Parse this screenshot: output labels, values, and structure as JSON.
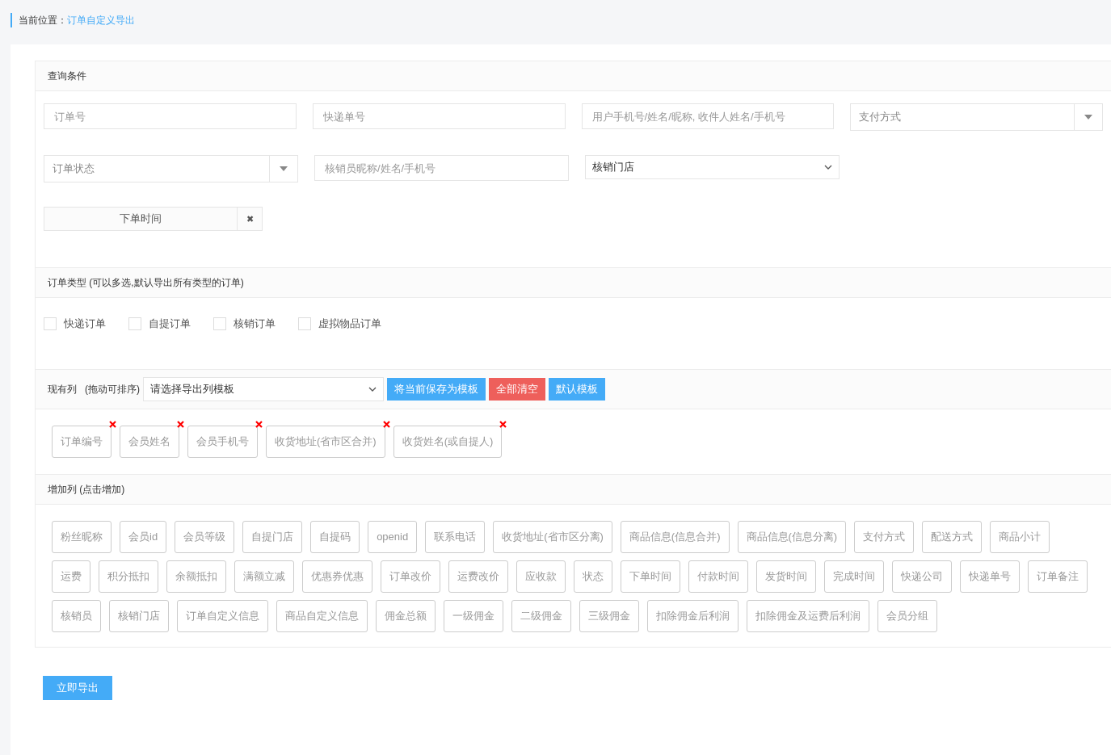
{
  "breadcrumb": {
    "label": "当前位置：",
    "current": "订单自定义导出"
  },
  "query": {
    "title": "查询条件",
    "rows": [
      [
        {
          "kind": "text",
          "placeholder": "订单号"
        },
        {
          "kind": "text",
          "placeholder": "快递单号"
        },
        {
          "kind": "text",
          "placeholder": "用户手机号/姓名/昵称, 收件人姓名/手机号"
        },
        {
          "kind": "select",
          "placeholder": "支付方式"
        }
      ],
      [
        {
          "kind": "select",
          "placeholder": "订单状态"
        },
        {
          "kind": "text",
          "placeholder": "核销员昵称/姓名/手机号"
        },
        {
          "kind": "dropdown",
          "value": "核销门店"
        }
      ],
      [
        {
          "kind": "date",
          "value": "下单时间",
          "clear": "✖"
        }
      ]
    ]
  },
  "order_type": {
    "title": "订单类型 (可以多选,默认导出所有类型的订单)",
    "options": [
      {
        "label": "快递订单",
        "checked": false
      },
      {
        "label": "自提订单",
        "checked": false
      },
      {
        "label": "核销订单",
        "checked": false
      },
      {
        "label": "虚拟物品订单",
        "checked": false
      }
    ]
  },
  "current_columns": {
    "title": "现有列",
    "hint": "(拖动可排序)",
    "template_select": "请选择导出列模板",
    "buttons": [
      {
        "label": "将当前保存为模板",
        "kind": "primary"
      },
      {
        "label": "全部清空",
        "kind": "danger"
      },
      {
        "label": "默认模板",
        "kind": "primary"
      }
    ],
    "columns": [
      "订单编号",
      "会员姓名",
      "会员手机号",
      "收货地址(省市区合并)",
      "收货姓名(或自提人)"
    ]
  },
  "add_columns": {
    "title": "增加列 (点击增加)",
    "columns": [
      "粉丝昵称",
      "会员id",
      "会员等级",
      "自提门店",
      "自提码",
      "openid",
      "联系电话",
      "收货地址(省市区分离)",
      "商品信息(信息合并)",
      "商品信息(信息分离)",
      "支付方式",
      "配送方式",
      "商品小计",
      "运费",
      "积分抵扣",
      "余额抵扣",
      "满额立减",
      "优惠券优惠",
      "订单改价",
      "运费改价",
      "应收款",
      "状态",
      "下单时间",
      "付款时间",
      "发货时间",
      "完成时间",
      "快递公司",
      "快递单号",
      "订单备注",
      "核销员",
      "核销门店",
      "订单自定义信息",
      "商品自定义信息",
      "佣金总额",
      "一级佣金",
      "二级佣金",
      "三级佣金",
      "扣除佣金后利润",
      "扣除佣金及运费后利润",
      "会员分组"
    ]
  },
  "export_button": "立即导出"
}
